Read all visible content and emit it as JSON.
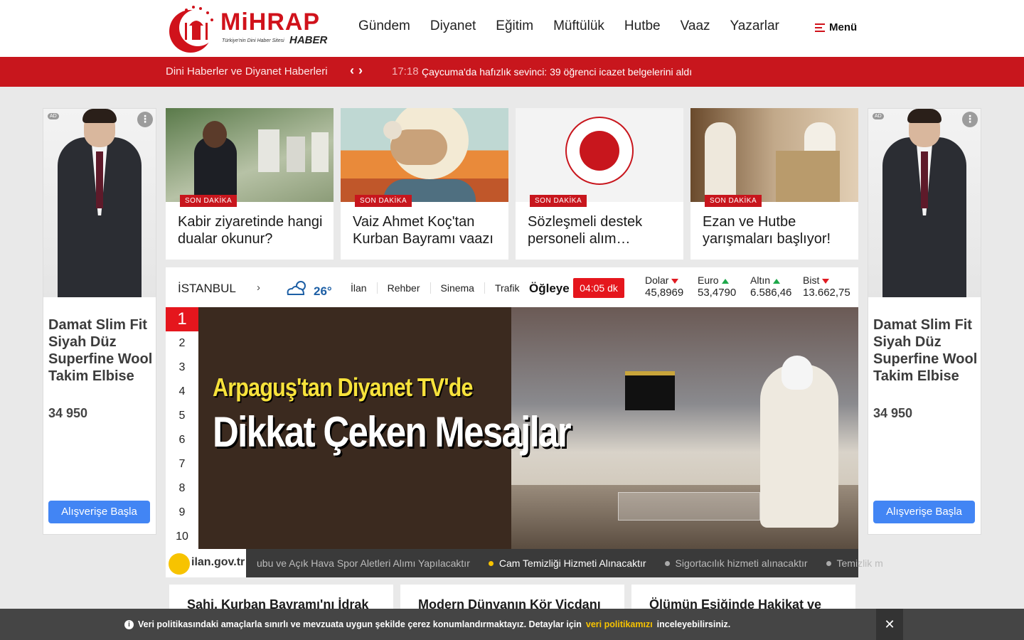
{
  "header": {
    "logo_text": "MiHRAP",
    "logo_sub": "Türkiye'nin Dini Haber Sitesi",
    "logo_haber": "HABER",
    "nav": [
      "Gündem",
      "Diyanet",
      "Eğitim",
      "Müftülük",
      "Hutbe",
      "Vaaz",
      "Yazarlar"
    ],
    "menu_label": "Menü"
  },
  "breaking": {
    "title": "Dini Haberler ve Diyanet Haberleri",
    "prev": "‹",
    "next": "›",
    "time": "17:18",
    "headline": "Çaycuma'da hafızlık sevinci: 39 öğrenci icazet belgelerini aldı"
  },
  "ads": {
    "badge": "AD",
    "more": "⋮",
    "title": "Damat Slim Fit Siyah Düz Superfine Wool Takim Elbise",
    "price": "34 950",
    "cta": "Alışverişe Başla"
  },
  "cards": [
    {
      "badge": "SON DAKİKA",
      "title": "Kabir ziyaretinde hangi dualar okunur?"
    },
    {
      "badge": "SON DAKİKA",
      "title": "Vaiz Ahmet Koç'tan Kurban Bayramı vaazı"
    },
    {
      "badge": "SON DAKİKA",
      "title": "Sözleşmeli destek personeli alım…"
    },
    {
      "badge": "SON DAKİKA",
      "title": "Ezan ve Hutbe yarışmaları başlıyor!"
    }
  ],
  "infobar": {
    "city": "İSTANBUL",
    "city_arrow": "›",
    "temperature": "26°",
    "links": [
      "İlan",
      "Rehber",
      "Sinema",
      "Trafik"
    ],
    "prayer_name": "Öğleye",
    "prayer_time": "04:05 dk",
    "markets": [
      {
        "name": "Dolar",
        "value": "45,8969",
        "trend": "down"
      },
      {
        "name": "Euro",
        "value": "53,4790",
        "trend": "up"
      },
      {
        "name": "Altın",
        "value": "6.586,46",
        "trend": "up"
      },
      {
        "name": "Bist",
        "value": "13.662,75",
        "trend": "down"
      }
    ]
  },
  "slider": {
    "numbers": [
      "1",
      "2",
      "3",
      "4",
      "5",
      "6",
      "7",
      "8",
      "9",
      "10"
    ],
    "active": 1,
    "headline_top": "Arpaguş'tan Diyanet TV'de",
    "headline_main": "Dikkat Çeken Mesajlar"
  },
  "ticker": {
    "logo": "ilan.gov.tr",
    "items": [
      "ubu ve Açık Hava Spor Aletleri Alımı Yapılacaktır",
      "Cam Temizliği Hizmeti Alınacaktır",
      "Sigortacılık hizmeti alınacaktır",
      "Temizlik m"
    ]
  },
  "bottom_cards": [
    "Sahi, Kurban Bayramı'nı İdrak",
    "Modern Dünyanın Kör Vicdanı",
    "Ölümün Eşiğinde Hakikat ve"
  ],
  "cookie": {
    "text_before": "Veri politikasındaki amaçlarla sınırlı ve mevzuata uygun şekilde çerez konumlandırmaktayız. Detaylar için",
    "link": "veri politikamızı",
    "text_after": "inceleyebilirsiniz.",
    "close": "✕"
  },
  "colors": {
    "brand_red": "#c8161d",
    "accent_yellow": "#f7c300"
  }
}
